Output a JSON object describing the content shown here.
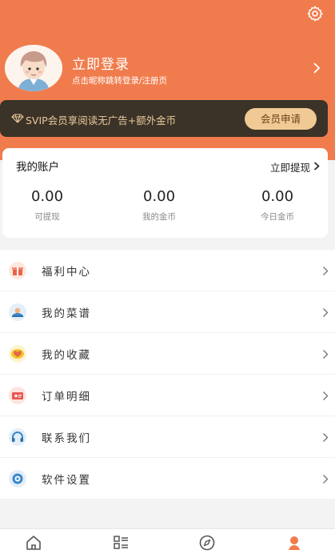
{
  "header": {
    "login_title": "立即登录",
    "login_subtitle": "点击昵称跳转登录/注册页",
    "settings_icon": "gear-icon",
    "brand_color": "#f07c4d"
  },
  "vip": {
    "text": "SVIP会员享阅读无广告+额外金币",
    "button": "会员申请",
    "icon": "diamond-icon"
  },
  "account": {
    "title": "我的账户",
    "withdraw_link": "立即提现",
    "stats": [
      {
        "value": "0.00",
        "label": "可提现"
      },
      {
        "value": "0.00",
        "label": "我的金币"
      },
      {
        "value": "0.00",
        "label": "今日金币"
      }
    ]
  },
  "menu": [
    {
      "label": "福利中心",
      "icon": "gift-icon"
    },
    {
      "label": "我的菜谱",
      "icon": "recipe-icon"
    },
    {
      "label": "我的收藏",
      "icon": "heart-icon"
    },
    {
      "label": "订单明细",
      "icon": "ticket-icon"
    },
    {
      "label": "联系我们",
      "icon": "headset-icon"
    },
    {
      "label": "软件设置",
      "icon": "settings-icon"
    }
  ],
  "tabbar": [
    {
      "icon": "home-icon",
      "active": false
    },
    {
      "icon": "list-icon",
      "active": false
    },
    {
      "icon": "compass-icon",
      "active": false
    },
    {
      "icon": "profile-icon",
      "active": true
    }
  ]
}
